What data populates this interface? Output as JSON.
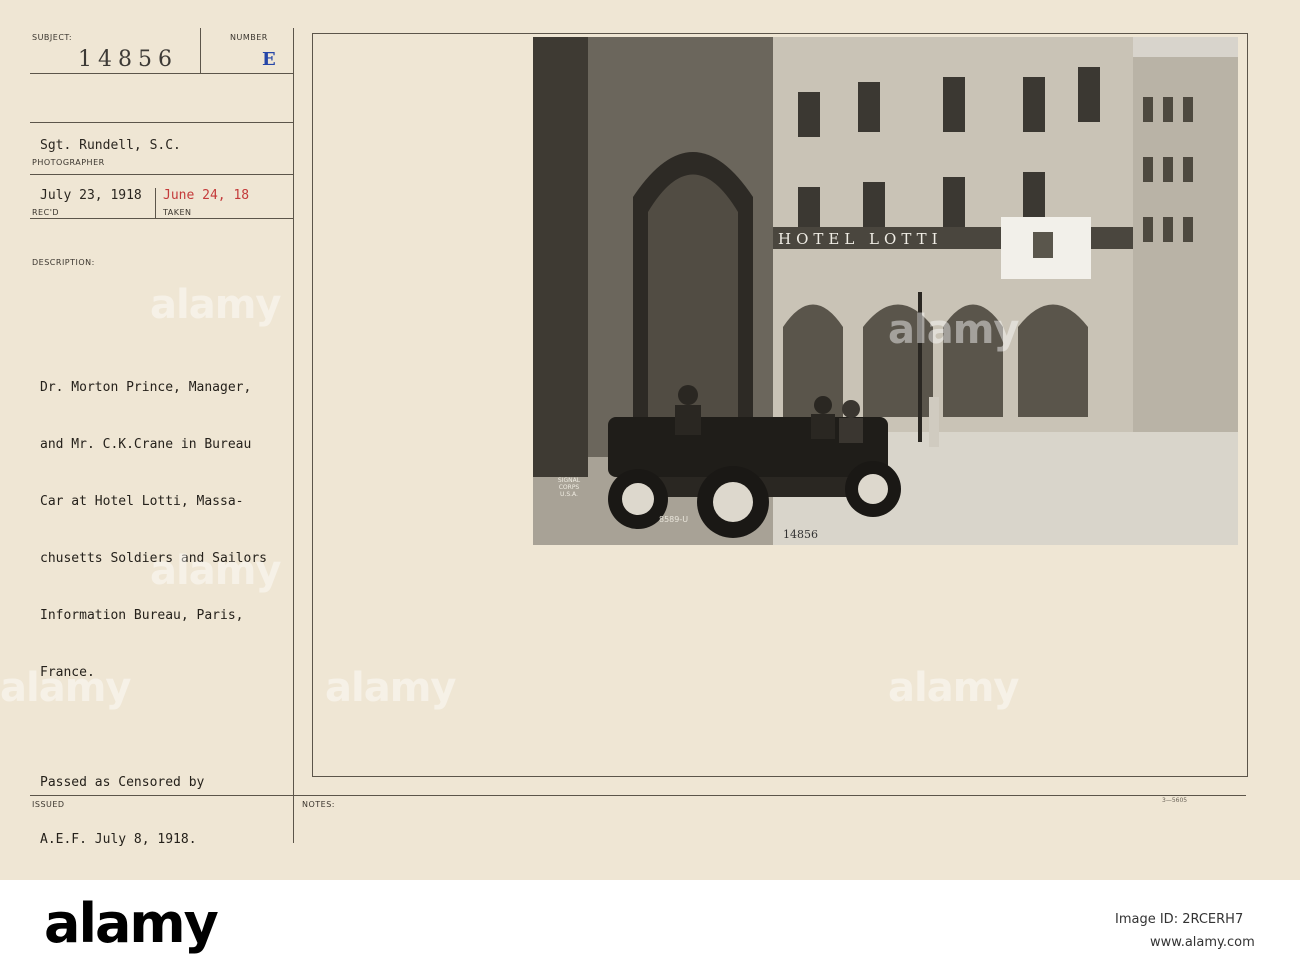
{
  "card": {
    "subject_label": "SUBJECT:",
    "subject_value": "14856",
    "number_label": "NUMBER",
    "number_value": "E",
    "photographer_name": "Sgt. Rundell, S.C.",
    "photographer_label": "PHOTOGRAPHER",
    "recd_date": "July 23, 1918",
    "taken_date": "June 24, 18",
    "recd_label": "REC'D",
    "taken_label": "TAKEN",
    "description_label": "DESCRIPTION:",
    "description_lines": [
      "Dr. Morton Prince, Manager,",
      "and Mr. C.K.Crane in Bureau",
      "Car at Hotel Lotti, Massa-",
      "chusetts Soldiers and Sailors",
      "Information Bureau, Paris,",
      "France."
    ],
    "censored_lines": [
      "Passed as Censored by",
      "A.E.F. July 8, 1918."
    ],
    "issued_label": "ISSUED",
    "notes_label": "NOTES:",
    "form_code": "3—5605"
  },
  "photo": {
    "hotel_sign": "HOTEL LOTTI",
    "plate": "8589-U",
    "stamp": "SIGNAL CORPS U.S.A.",
    "inscription": "14856"
  },
  "watermark": "alamy",
  "footer": {
    "logo": "alamy",
    "image_id_label": "Image ID: 2RCERH7",
    "url": "www.alamy.com"
  },
  "colors": {
    "card_bg": "#efe6d4",
    "typed_red": "#c43a3a",
    "stamp_blue": "#2546a8"
  }
}
